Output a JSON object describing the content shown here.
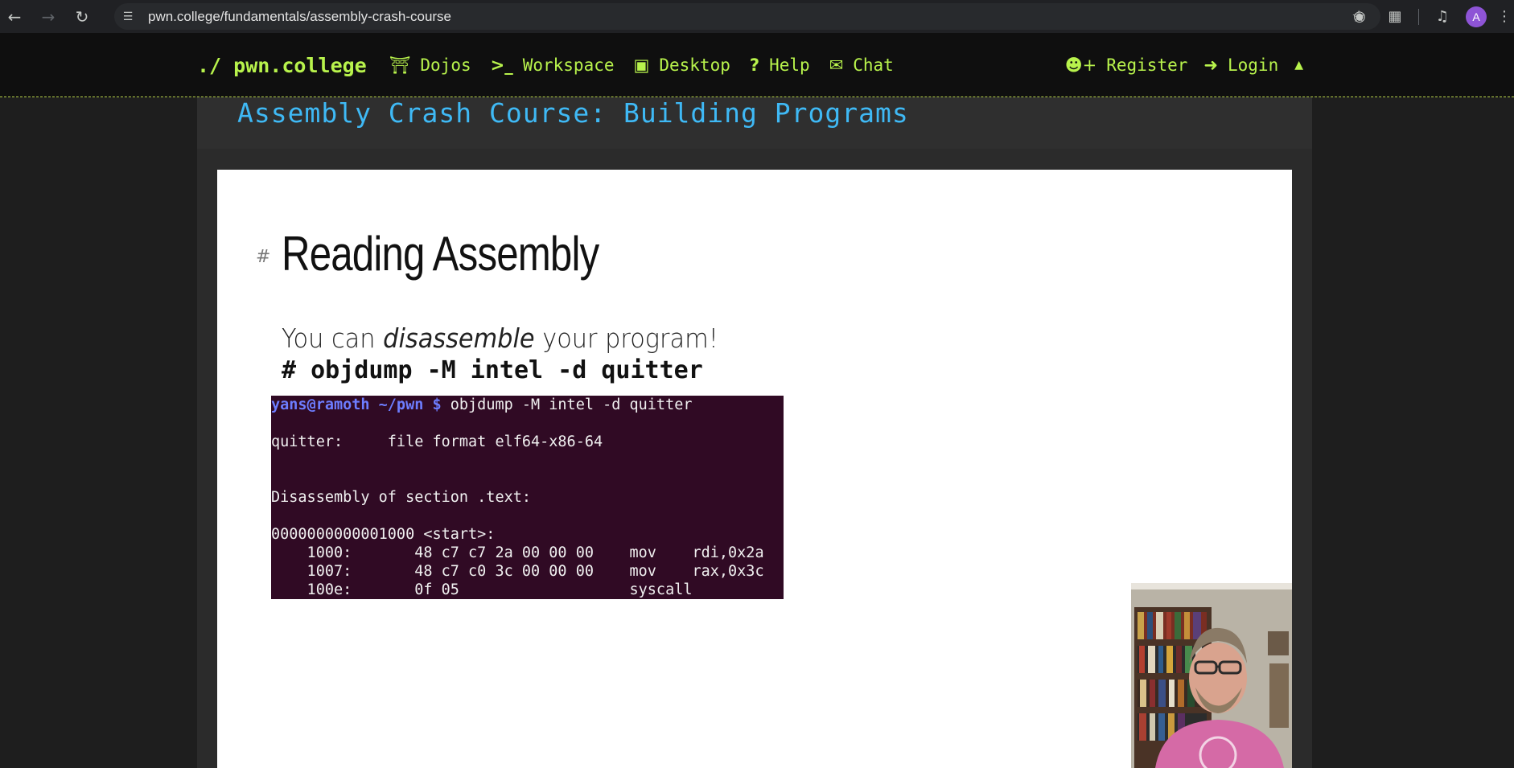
{
  "browser": {
    "url": "pwn.college/fundamentals/assembly-crash-course",
    "avatar_letter": "A"
  },
  "site_nav": {
    "brand": "./ pwn.college",
    "links": [
      {
        "icon": "torii-gate-icon",
        "label": "Dojos"
      },
      {
        "icon": "terminal-icon",
        "label": "Workspace"
      },
      {
        "icon": "desktop-icon",
        "label": "Desktop"
      },
      {
        "icon": "question-icon",
        "label": "Help"
      },
      {
        "icon": "chat-icon",
        "label": "Chat"
      }
    ],
    "register_label": "Register",
    "login_label": "Login"
  },
  "module": {
    "title": "Assembly Crash Course: Building Programs"
  },
  "slide": {
    "hash": "#",
    "heading": "Reading Assembly",
    "text_before": "You can ",
    "text_em": "disassemble",
    "text_after": " your program!",
    "command": "# objdump -M intel -d quitter",
    "terminal": {
      "prompt_user": "yans@ramoth ~/pwn $",
      "prompt_cmd": " objdump -M intel -d quitter",
      "lines": [
        "",
        "quitter:     file format elf64-x86-64",
        "",
        "",
        "Disassembly of section .text:",
        "",
        "0000000000001000 <start>:",
        "    1000:       48 c7 c7 2a 00 00 00    mov    rdi,0x2a",
        "    1007:       48 c7 c0 3c 00 00 00    mov    rax,0x3c",
        "    100e:       0f 05                   syscall"
      ]
    }
  },
  "colors": {
    "accent": "#b8f34c",
    "title_blue": "#3fb9f5",
    "terminal_bg": "#300a24"
  }
}
